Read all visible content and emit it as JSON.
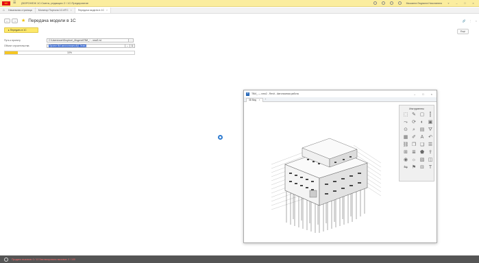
{
  "app": {
    "logo_text": "1С",
    "title": "(ВОРОНЕЖ 1С:Смета, редакция 2 / 1С:Предприятие",
    "user": "Мышкина Людмила Николаевна"
  },
  "tabs": [
    {
      "label": "Начальная страница"
    },
    {
      "label": "Монитор Портала 1С:ИТС"
    },
    {
      "label": "Передача модели в 1С"
    }
  ],
  "form": {
    "title": "Передача модели в 1С",
    "more_label": "Еще",
    "transfer_button": "Передать в 1С",
    "project_path_label": "Путь к проекту",
    "project_path_value": "C:\\Users\\user\\Dropbox\\_Модели\\ТВИ_~ - new2.rvt",
    "construction_object_label": "Объект строительства",
    "construction_object_value": "Проект ВИ-многоэтажный(1 Этап)",
    "progress_fraction": 0.1,
    "progress_text": "10%"
  },
  "revit": {
    "title": "ТВИ_ — new2 - Revit - Автономная работа",
    "tab_label": "3D Вид",
    "tools_title": "Инструменты",
    "tools": [
      "select-icon",
      "measure-icon",
      "box-icon",
      "pin-icon",
      "move-icon",
      "rotate-icon",
      "hide-icon",
      "isolate-icon",
      "orbit-icon",
      "zoom-icon",
      "section-icon",
      "filter-icon",
      "grid-icon",
      "pen-icon",
      "text-icon",
      "undo-icon",
      "link-icon",
      "copy-icon",
      "paste-icon",
      "property-icon",
      "window-icon",
      "layer-icon",
      "tag-icon",
      "export-icon",
      "camera-icon",
      "light-icon",
      "material-icon",
      "chart-icon",
      "mirror-icon",
      "flag-icon",
      "align-icon",
      "text-tool-icon"
    ]
  },
  "status": {
    "text": "Продано вызовов: 0 / 10   Запланировано вызовов: 0 / 100"
  },
  "colors": {
    "titlebar": "#fbed9e",
    "button_yellow": "#fde86a",
    "progress": "#f5c623",
    "status_bar": "#555555"
  }
}
